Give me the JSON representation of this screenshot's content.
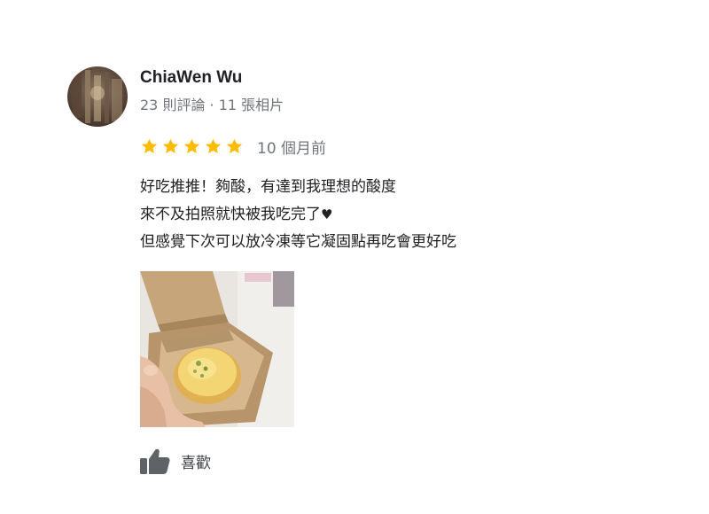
{
  "review": {
    "author_name": "ChiaWen Wu",
    "author_meta": "23 則評論 · 11 張相片",
    "rating": 5,
    "rating_max": 5,
    "date": "10 個月前",
    "text_lines": [
      "好吃推推！夠酸，有達到我理想的酸度",
      "來不及拍照就快被我吃完了",
      "但感覺下次可以放冷凍等它凝固點再吃會更好吃"
    ],
    "heart_glyph": "♥",
    "like_label": "喜歡"
  },
  "icons": {
    "star": "star-icon",
    "like": "thumbs-up-icon",
    "heart": "heart-icon"
  },
  "colors": {
    "star": "#fbbc04",
    "meta_text": "#70757a",
    "body_text": "#202124"
  }
}
